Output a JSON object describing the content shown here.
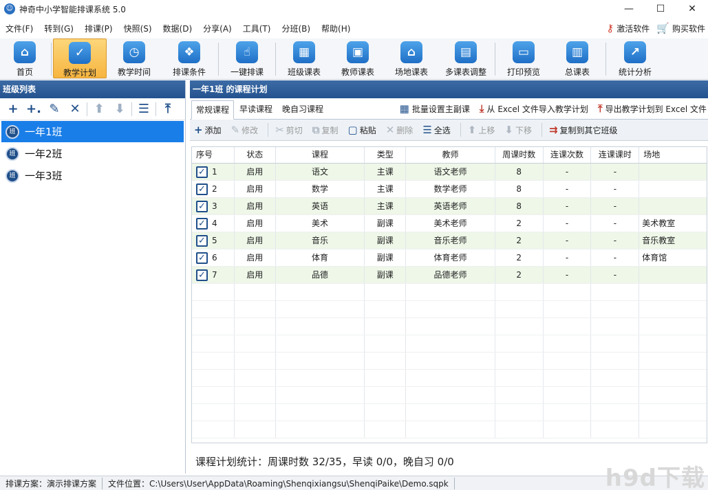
{
  "window": {
    "title": "神奇中小学智能排课系统 5.0",
    "controls": [
      "—",
      "☐",
      "✕"
    ]
  },
  "menu": [
    "文件(F)",
    "转到(G)",
    "排课(P)",
    "快照(S)",
    "数据(D)",
    "分享(A)",
    "工具(T)",
    "分班(B)",
    "帮助(H)"
  ],
  "menu_right": {
    "activate": "激活软件",
    "buy": "购买软件"
  },
  "toolbar": [
    {
      "label": "首页",
      "icon": "home-icon",
      "glyph": "⌂"
    },
    {
      "label": "教学计划",
      "icon": "clipboard-icon",
      "glyph": "✓"
    },
    {
      "label": "教学时间",
      "icon": "clock-icon",
      "glyph": "◷"
    },
    {
      "label": "排课条件",
      "icon": "cubes-icon",
      "glyph": "❖"
    },
    {
      "label": "一键排课",
      "icon": "hand-pointer-icon",
      "glyph": "☝"
    },
    {
      "label": "班级课表",
      "icon": "calendar-icon",
      "glyph": "▦"
    },
    {
      "label": "教师课表",
      "icon": "teacher-icon",
      "glyph": "▣"
    },
    {
      "label": "场地课表",
      "icon": "building-icon",
      "glyph": "⌂"
    },
    {
      "label": "多课表调整",
      "icon": "multi-table-icon",
      "glyph": "▤"
    },
    {
      "label": "打印预览",
      "icon": "printer-icon",
      "glyph": "▭"
    },
    {
      "label": "总课表",
      "icon": "master-table-icon",
      "glyph": "▥"
    },
    {
      "label": "统计分析",
      "icon": "chart-icon",
      "glyph": "↗"
    }
  ],
  "left": {
    "header": "班级列表",
    "classes": [
      "一年1班",
      "一年2班",
      "一年3班"
    ],
    "class_badge": "班"
  },
  "right": {
    "header": "一年1班 的课程计划",
    "tabs": [
      "常规课程",
      "早读课程",
      "晚自习课程"
    ],
    "tab_actions": [
      "批量设置主副课",
      "从 Excel 文件导入教学计划",
      "导出教学计划到 Excel 文件"
    ],
    "grid_tools": [
      "添加",
      "修改",
      "剪切",
      "复制",
      "粘贴",
      "删除",
      "全选",
      "上移",
      "下移",
      "复制到其它班级"
    ],
    "columns": [
      "序号",
      "状态",
      "课程",
      "类型",
      "教师",
      "周课时数",
      "连课次数",
      "连课课时",
      "场地"
    ],
    "rows": [
      [
        "1",
        "启用",
        "语文",
        "主课",
        "语文老师",
        "8",
        "-",
        "-",
        ""
      ],
      [
        "2",
        "启用",
        "数学",
        "主课",
        "数学老师",
        "8",
        "-",
        "-",
        ""
      ],
      [
        "3",
        "启用",
        "英语",
        "主课",
        "英语老师",
        "8",
        "-",
        "-",
        ""
      ],
      [
        "4",
        "启用",
        "美术",
        "副课",
        "美术老师",
        "2",
        "-",
        "-",
        "美术教室"
      ],
      [
        "5",
        "启用",
        "音乐",
        "副课",
        "音乐老师",
        "2",
        "-",
        "-",
        "音乐教室"
      ],
      [
        "6",
        "启用",
        "体育",
        "副课",
        "体育老师",
        "2",
        "-",
        "-",
        "体育馆"
      ],
      [
        "7",
        "启用",
        "品德",
        "副课",
        "品德老师",
        "2",
        "-",
        "-",
        ""
      ]
    ],
    "summary": "课程计划统计：周课时数 32/35，早读 0/0，晚自习 0/0"
  },
  "status": {
    "plan": "排课方案：演示排课方案",
    "file": "文件位置：C:\\Users\\User\\AppData\\Roaming\\Shenqixiangsu\\ShenqiPaike\\Demo.sqpk"
  },
  "watermark": "h9d下载",
  "colors": {
    "accent": "#1a7ee8",
    "header": "#2b5a95",
    "active_tool": "#f7b540",
    "alt_row": "#eef7e8"
  }
}
